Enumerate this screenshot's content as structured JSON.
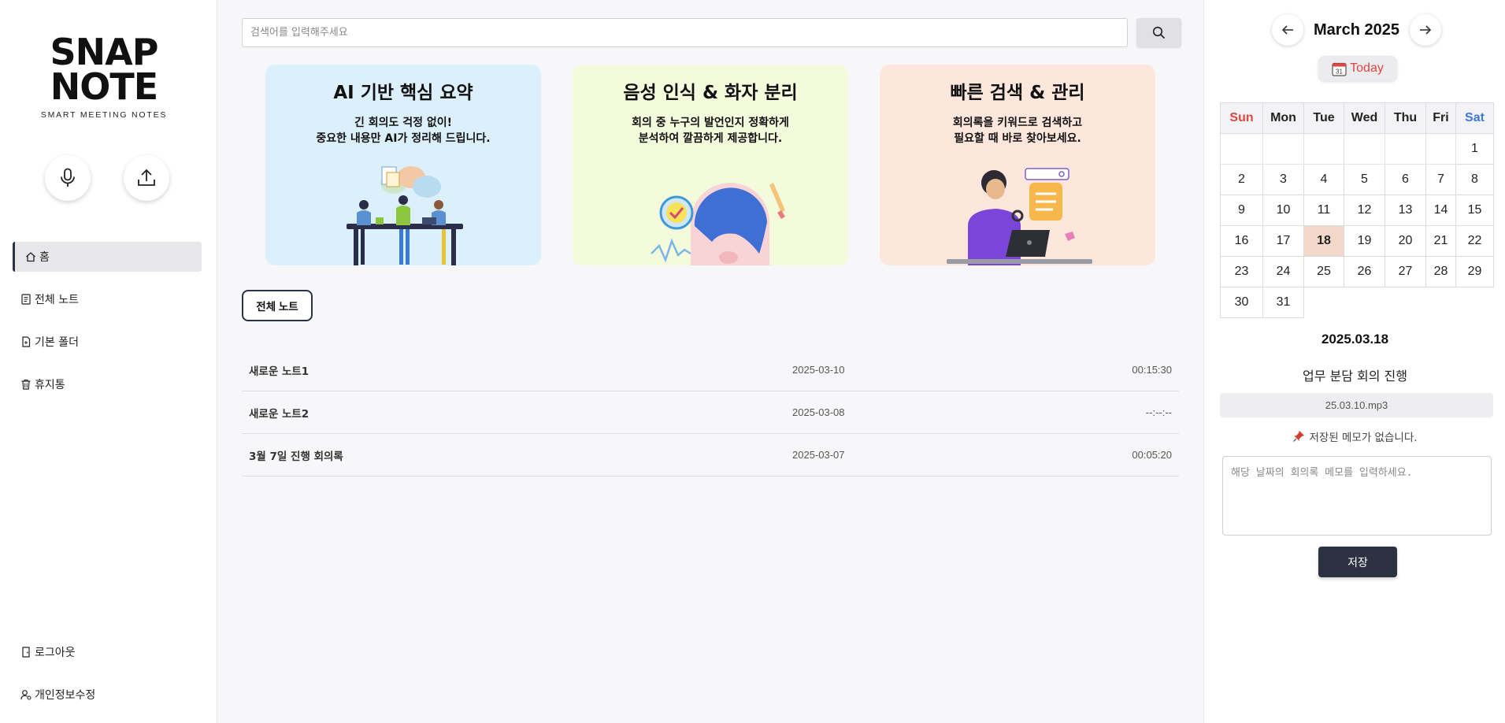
{
  "sidebar": {
    "logo_line1": "SNAP",
    "logo_line2": "NOTE",
    "logo_tagline": "SMART MEETING NOTES",
    "record_icon": "microphone-icon",
    "upload_icon": "upload-icon",
    "nav": [
      {
        "label": "홈",
        "icon": "home-icon",
        "active": true
      },
      {
        "label": "전체 노트",
        "icon": "notes-icon",
        "active": false
      },
      {
        "label": "기본 폴더",
        "icon": "folder-icon",
        "active": false
      },
      {
        "label": "휴지통",
        "icon": "trash-icon",
        "active": false
      }
    ],
    "bottom_nav": [
      {
        "label": "로그아웃",
        "icon": "logout-icon"
      },
      {
        "label": "개인정보수정",
        "icon": "user-settings-icon"
      }
    ]
  },
  "search": {
    "placeholder": "검색어를 입력해주세요",
    "icon": "search-icon"
  },
  "feature_cards": [
    {
      "title": "AI 기반 핵심 요약",
      "desc": "긴 회의도 걱정 없이!\n중요한 내용만 AI가 정리해 드립니다.",
      "bg": "#dbf0fb"
    },
    {
      "title": "음성 인식 & 화자 분리",
      "desc": "회의 중 누구의 발언인지 정확하게\n분석하여 깔끔하게 제공합니다.",
      "bg": "#f4fbdc"
    },
    {
      "title": "빠른 검색 & 관리",
      "desc": "회의록을 키워드로 검색하고\n필요할 때 바로 찾아보세요.",
      "bg": "#fde6dc"
    }
  ],
  "notes_tab": "전체 노트",
  "notes": [
    {
      "title": "새로운 노트1",
      "date": "2025-03-10",
      "duration": "00:15:30"
    },
    {
      "title": "새로운 노트2",
      "date": "2025-03-08",
      "duration": "--:--:--"
    },
    {
      "title": "3월 7일 진행 회의록",
      "date": "2025-03-07",
      "duration": "00:05:20"
    }
  ],
  "calendar": {
    "month_label": "March 2025",
    "prev_icon": "arrow-left-icon",
    "next_icon": "arrow-right-icon",
    "today_label": "Today",
    "today_icon_day": "31",
    "weekdays": [
      "Sun",
      "Mon",
      "Tue",
      "Wed",
      "Thu",
      "Fri",
      "Sat"
    ],
    "weeks": [
      [
        "",
        "",
        "",
        "",
        "",
        "",
        "1"
      ],
      [
        "2",
        "3",
        "4",
        "5",
        "6",
        "7",
        "8"
      ],
      [
        "9",
        "10",
        "11",
        "12",
        "13",
        "14",
        "15"
      ],
      [
        "16",
        "17",
        "18",
        "19",
        "20",
        "21",
        "22"
      ],
      [
        "23",
        "24",
        "25",
        "26",
        "27",
        "28",
        "29"
      ],
      [
        "30",
        "31"
      ]
    ],
    "selected_day": "18",
    "selected_color": "#f2d8c9",
    "sunday_color": "#e0453f",
    "saturday_color": "#3b78d8"
  },
  "detail": {
    "date": "2025.03.18",
    "meeting_title": "업무 분담 회의 진행",
    "file": "25.03.10.mp3",
    "no_memo_icon": "pushpin-icon",
    "no_memo_text": "저장된 메모가 없습니다.",
    "memo_placeholder": "해당 날짜의 회의록 메모를 입력하세요.",
    "save_label": "저장"
  },
  "colors": {
    "accent": "#2d3242",
    "today_text": "#e0453f"
  }
}
